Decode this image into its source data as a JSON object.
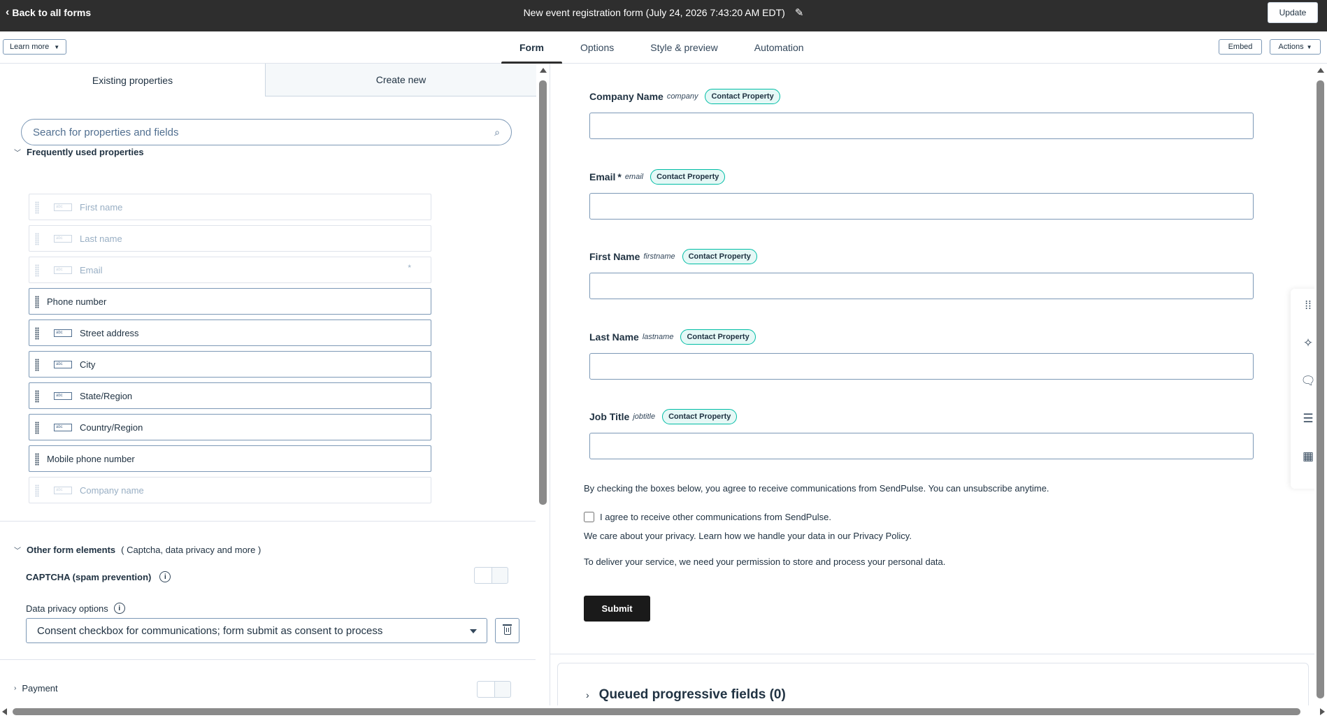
{
  "topbar": {
    "back_label": "Back to all forms",
    "form_title": "New event registration form (July 24, 2026 7:43:20 AM EDT)",
    "update_label": "Update"
  },
  "subnav": {
    "learn_more": "Learn more",
    "tabs": [
      {
        "label": "Form",
        "active": true
      },
      {
        "label": "Options",
        "active": false
      },
      {
        "label": "Style & preview",
        "active": false
      },
      {
        "label": "Automation",
        "active": false
      }
    ],
    "embed_label": "Embed",
    "actions_label": "Actions"
  },
  "left": {
    "tabs": [
      "Existing properties",
      "Create new"
    ],
    "search_placeholder": "Search for properties and fields",
    "frequent_heading": "Frequently used properties",
    "properties": [
      {
        "label": "First name",
        "disabled": true,
        "icon": true,
        "required": false
      },
      {
        "label": "Last name",
        "disabled": true,
        "icon": true,
        "required": false
      },
      {
        "label": "Email",
        "disabled": true,
        "icon": true,
        "required": true
      },
      {
        "label": "Phone number",
        "disabled": false,
        "icon": false,
        "required": false
      },
      {
        "label": "Street address",
        "disabled": false,
        "icon": true,
        "required": false
      },
      {
        "label": "City",
        "disabled": false,
        "icon": true,
        "required": false
      },
      {
        "label": "State/Region",
        "disabled": false,
        "icon": true,
        "required": false
      },
      {
        "label": "Country/Region",
        "disabled": false,
        "icon": true,
        "required": false
      },
      {
        "label": "Mobile phone number",
        "disabled": false,
        "icon": false,
        "required": false
      },
      {
        "label": "Company name",
        "disabled": true,
        "icon": true,
        "required": false
      }
    ],
    "field_icon_text": "abc",
    "required_marker": "*",
    "other_heading": "Other form elements",
    "other_sub": "( Captcha, data privacy and more )",
    "captcha_label": "CAPTCHA (spam prevention)",
    "data_privacy_label": "Data privacy options",
    "data_privacy_value": "Consent checkbox for communications; form submit as consent to process",
    "payment_label": "Payment"
  },
  "preview": {
    "fields": [
      {
        "label": "Company Name",
        "internal": "company",
        "required": false,
        "badge": "Contact Property"
      },
      {
        "label": "Email",
        "internal": "email",
        "required": true,
        "badge": "Contact Property"
      },
      {
        "label": "First Name",
        "internal": "firstname",
        "required": false,
        "badge": "Contact Property"
      },
      {
        "label": "Last Name",
        "internal": "lastname",
        "required": false,
        "badge": "Contact Property"
      },
      {
        "label": "Job Title",
        "internal": "jobtitle",
        "required": false,
        "badge": "Contact Property"
      }
    ],
    "consent_intro": "By checking the boxes below, you agree to receive communications from SendPulse. You can unsubscribe anytime.",
    "consent_checkbox": "I agree to receive other communications from SendPulse.",
    "privacy_text": "We care about your privacy. Learn how we handle your data in our Privacy Policy.",
    "process_text": "To deliver your service, we need your permission to store and process your personal data.",
    "submit_label": "Submit",
    "queued_label": "Queued progressive fields (0)"
  },
  "rail_icons": [
    "grid-dots-icon",
    "sparkle-icon",
    "chat-icon",
    "checklist-icon",
    "calendar-icon"
  ],
  "colors": {
    "topbar_bg": "#2e2e2e",
    "badge_border": "#00bda5",
    "badge_bg": "#e5f8f6",
    "submit_bg": "#1a1a1a"
  }
}
